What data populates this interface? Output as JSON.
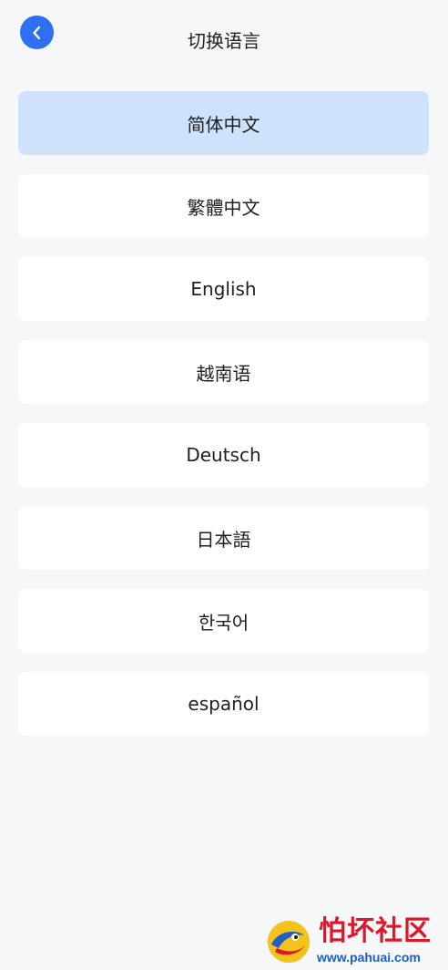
{
  "header": {
    "back_icon": "chevron-left-icon",
    "title": "切换语言"
  },
  "languages": [
    {
      "label": "简体中文",
      "selected": true
    },
    {
      "label": "繁體中文",
      "selected": false
    },
    {
      "label": "English",
      "selected": false
    },
    {
      "label": "越南语",
      "selected": false
    },
    {
      "label": "Deutsch",
      "selected": false
    },
    {
      "label": "日本語",
      "selected": false
    },
    {
      "label": "한국어",
      "selected": false
    },
    {
      "label": "español",
      "selected": false
    }
  ],
  "colors": {
    "accent": "#2f6ff3",
    "selected_bg": "#cfe2fb",
    "page_bg": "#f6f7f9",
    "watermark_red": "#e0152a",
    "watermark_blue": "#1d5fc4"
  },
  "watermark": {
    "title": "怕坏社区",
    "url": "www.pahuai.com"
  }
}
